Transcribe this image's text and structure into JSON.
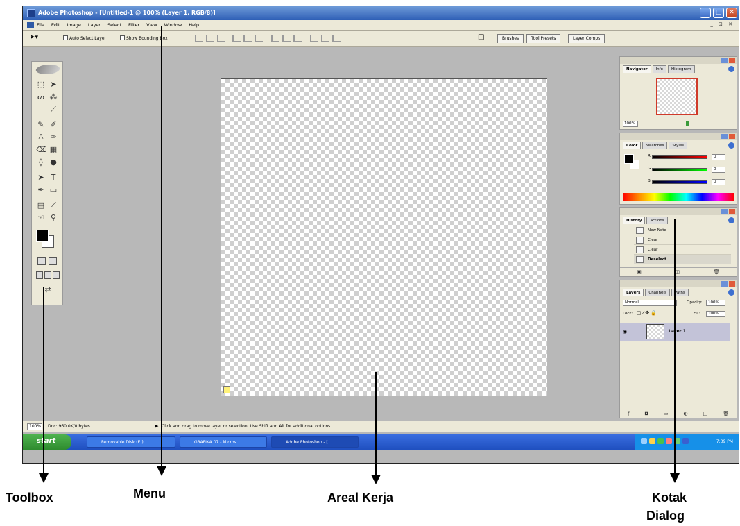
{
  "window": {
    "title": "Adobe Photoshop - [Untitled-1 @ 100% (Layer 1, RGB/8)]",
    "buttons": {
      "minimize": "_",
      "maximize": "□",
      "close": "✕"
    }
  },
  "menu": {
    "items": [
      "File",
      "Edit",
      "Image",
      "Layer",
      "Select",
      "Filter",
      "View",
      "Window",
      "Help"
    ],
    "doc_controls": "_ ⊡ ✕"
  },
  "options": {
    "auto_select_layer": "Auto Select Layer",
    "show_bounding_box": "Show Bounding Box",
    "palette_tabs": [
      "Brushes",
      "Tool Presets",
      "Layer Comps"
    ]
  },
  "navigator": {
    "tabs": [
      "Navigator",
      "Info",
      "Histogram"
    ],
    "zoom": "100%"
  },
  "color": {
    "tabs": [
      "Color",
      "Swatches",
      "Styles"
    ],
    "channels": [
      {
        "label": "R",
        "value": "0"
      },
      {
        "label": "G",
        "value": "0"
      },
      {
        "label": "B",
        "value": "0"
      }
    ]
  },
  "history": {
    "tabs": [
      "History",
      "Actions"
    ],
    "items": [
      "New Note",
      "Clear",
      "Clear",
      "Deselect"
    ]
  },
  "layers": {
    "tabs": [
      "Layers",
      "Channels",
      "Paths"
    ],
    "blend_mode": "Normal",
    "opacity_label": "Opacity:",
    "opacity": "100%",
    "lock_label": "Lock:",
    "fill_label": "Fill:",
    "fill": "100%",
    "layer_name": "Layer 1"
  },
  "status": {
    "zoom": "100%",
    "doc": "Doc: 960.0K/0 bytes",
    "hint": "Click and drag to move layer or selection.  Use Shift and Alt for additional options."
  },
  "taskbar": {
    "start": "start",
    "items": [
      "Removable Disk (E:)",
      "GRAFIKA 07 - Micros...",
      "Adobe Photoshop - [..."
    ],
    "clock": "7:39 PM"
  },
  "annotations": {
    "toolbox": "Toolbox",
    "menu": "Menu",
    "areal_kerja": "Areal Kerja",
    "kotak_dialog_1": "Kotak",
    "kotak_dialog_2": "Dialog"
  }
}
